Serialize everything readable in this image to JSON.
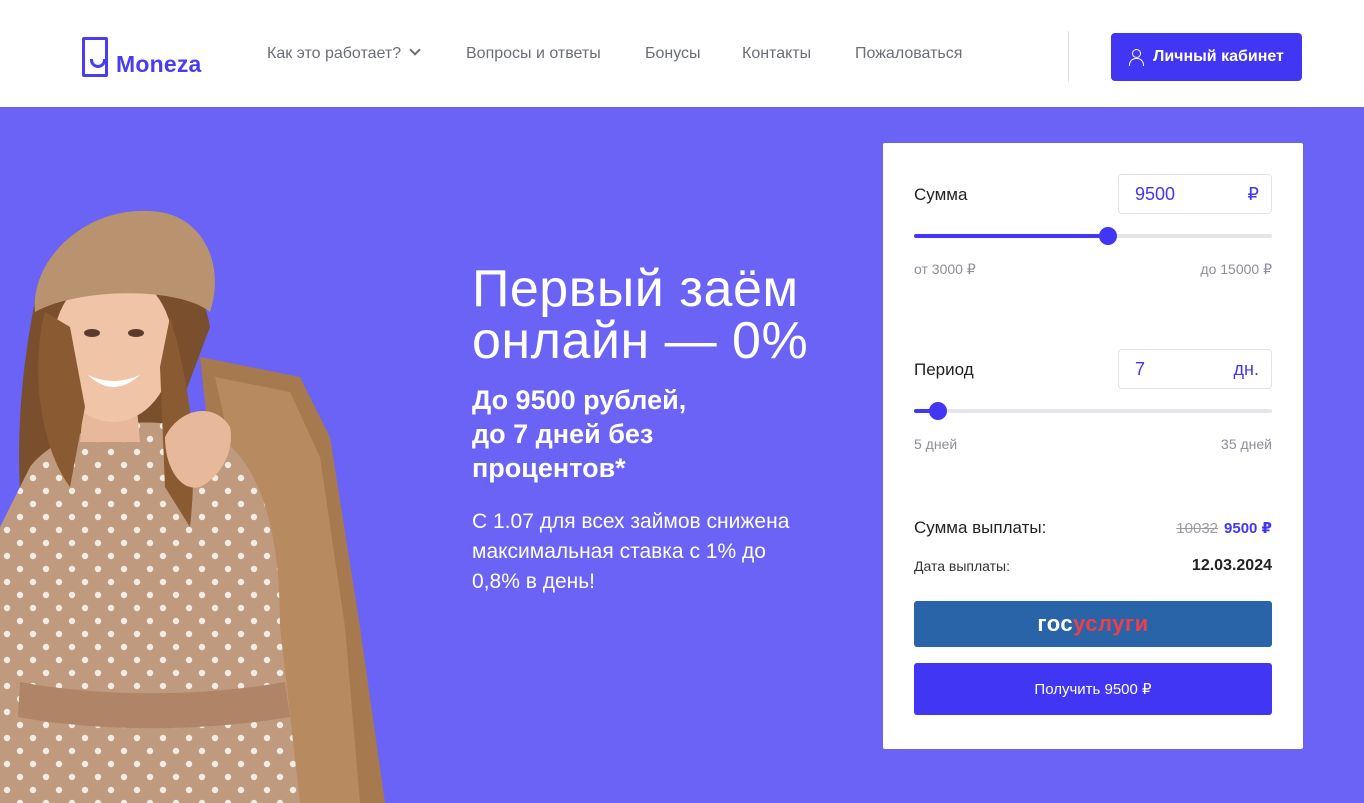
{
  "brand": {
    "name": "Moneza"
  },
  "nav": {
    "items": [
      {
        "label": "Как это работает?"
      },
      {
        "label": "Вопросы и ответы"
      },
      {
        "label": "Бонусы"
      },
      {
        "label": "Контакты"
      },
      {
        "label": "Пожаловаться"
      }
    ],
    "cabinet_label": "Личный кабинет"
  },
  "hero": {
    "title_line1": "Первый заём",
    "title_line2": "онлайн — 0%",
    "sub_line1": "До 9500 рублей,",
    "sub_line2": "до 7 дней без",
    "sub_line3": "процентов*",
    "note_line1": "С 1.07 для всех займов снижена",
    "note_line2": "максимальная ставка с 1% до",
    "note_line3": "0,8% в день!"
  },
  "calculator": {
    "amount": {
      "label": "Сумма",
      "value": "9500",
      "unit": "₽",
      "min_label": "от 3000 ₽",
      "max_label": "до 15000 ₽",
      "min": 3000,
      "max": 15000,
      "current": 9500
    },
    "period": {
      "label": "Период",
      "value": "7",
      "unit": "дн.",
      "min_label": "5 дней",
      "max_label": "35 дней",
      "min": 5,
      "max": 35,
      "current": 7
    },
    "payout_label": "Сумма выплаты:",
    "payout_old": "10032",
    "payout_new": "9500 ₽",
    "date_label": "Дата выплаты:",
    "date_value": "12.03.2024",
    "gosuslugi_part1": "гос",
    "gosuslugi_part2": "услуги",
    "get_button": "Получить 9500 ₽"
  },
  "colors": {
    "accent": "#4236f5",
    "hero_bg": "#6a63f6",
    "gosuslugi_blue": "#2a64a8",
    "gosuslugi_red": "#ef3e4a"
  }
}
